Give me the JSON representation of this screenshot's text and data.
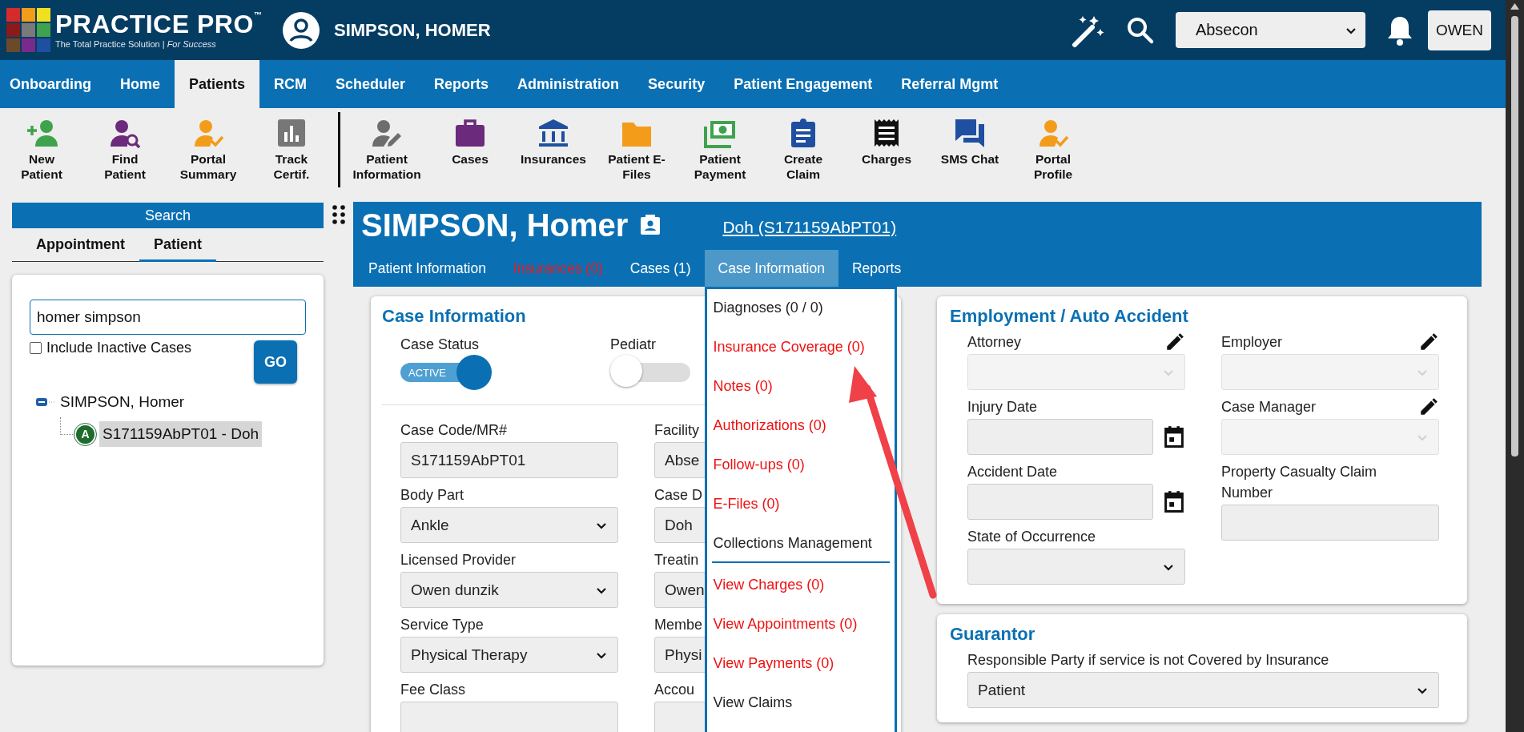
{
  "header": {
    "logo": {
      "title": "PRACTICE PRO",
      "trademark": "™",
      "tagline": "The Total Practice Solution | *For Success*"
    },
    "patient_name": "SIMPSON, HOMER",
    "location": "Absecon",
    "user": "OWEN"
  },
  "nav": [
    {
      "label": "Onboarding",
      "selected": false
    },
    {
      "label": "Home",
      "selected": false
    },
    {
      "label": "Patients",
      "selected": true
    },
    {
      "label": "RCM",
      "selected": false
    },
    {
      "label": "Scheduler",
      "selected": false
    },
    {
      "label": "Reports",
      "selected": false
    },
    {
      "label": "Administration",
      "selected": false
    },
    {
      "label": "Security",
      "selected": false
    },
    {
      "label": "Patient Engagement",
      "selected": false
    },
    {
      "label": "Referral Mgmt",
      "selected": false
    }
  ],
  "toolbar": {
    "groups": [
      [
        {
          "label": "New Patient"
        },
        {
          "label": "Find Patient"
        },
        {
          "label": "Portal Summary"
        },
        {
          "label": "Track Certif."
        }
      ],
      [
        {
          "label": "Patient Information"
        },
        {
          "label": "Cases"
        },
        {
          "label": "Insurances"
        },
        {
          "label": "Patient E-Files"
        },
        {
          "label": "Patient Payment"
        },
        {
          "label": "Create Claim"
        },
        {
          "label": "Charges"
        },
        {
          "label": "SMS Chat"
        },
        {
          "label": "Portal Profile"
        }
      ]
    ]
  },
  "sidebar": {
    "title": "Search",
    "tabs": [
      {
        "label": "Appointment",
        "selected": false
      },
      {
        "label": "Patient",
        "selected": true
      }
    ],
    "search_field": {
      "value": "homer simpson"
    },
    "include_inactive": {
      "label": "Include Inactive Cases",
      "checked": false
    },
    "go_button": "GO",
    "tree": [
      {
        "label": "SIMPSON, Homer",
        "expanded": true,
        "children": [
          {
            "badge": "A",
            "label": "S171159AbPT01 - Doh",
            "selected": true
          }
        ]
      }
    ]
  },
  "patient": {
    "name": "SIMPSON, Homer",
    "case_link": "Doh (S171159AbPT01)",
    "tabs": [
      {
        "label": "Patient Information",
        "selected": false,
        "warning": false
      },
      {
        "label": "Insurances (0)",
        "selected": false,
        "warning": true
      },
      {
        "label": "Cases (1)",
        "selected": false,
        "warning": false
      },
      {
        "label": "Case Information",
        "selected": true,
        "warning": false
      },
      {
        "label": "Reports",
        "selected": false,
        "warning": false
      }
    ]
  },
  "case_menu": {
    "items": [
      {
        "label": "Diagnoses (0 / 0)",
        "warning": false,
        "separator_after": false
      },
      {
        "label": "Insurance Coverage (0)",
        "warning": true,
        "separator_after": false
      },
      {
        "label": "Notes (0)",
        "warning": true,
        "separator_after": false
      },
      {
        "label": "Authorizations (0)",
        "warning": true,
        "separator_after": false
      },
      {
        "label": "Follow-ups (0)",
        "warning": true,
        "separator_after": false
      },
      {
        "label": "E-Files (0)",
        "warning": true,
        "separator_after": false
      },
      {
        "label": "Collections Management",
        "warning": false,
        "separator_after": true
      },
      {
        "label": "View Charges (0)",
        "warning": true,
        "separator_after": false
      },
      {
        "label": "View Appointments (0)",
        "warning": true,
        "separator_after": false
      },
      {
        "label": "View Payments (0)",
        "warning": true,
        "separator_after": false
      },
      {
        "label": "View Claims",
        "warning": false,
        "separator_after": false
      }
    ]
  },
  "case_information": {
    "title": "Case Information",
    "switches": [
      {
        "label": "Case Status",
        "on": true,
        "text": "ACTIVE"
      },
      {
        "label": "Pediatr",
        "on": false
      }
    ],
    "columns": [
      [
        {
          "label": "Case Code/MR#",
          "kind": "text",
          "value": "S171159AbPT01"
        },
        {
          "label": "Body Part",
          "kind": "select",
          "value": "Ankle"
        },
        {
          "label": "Licensed Provider",
          "kind": "select",
          "value": "Owen dunzik"
        },
        {
          "label": "Service Type",
          "kind": "select",
          "value": "Physical Therapy"
        },
        {
          "label": "Fee Class",
          "kind": "text"
        }
      ],
      [
        {
          "label": "Facility",
          "kind": "text",
          "value": "Abse"
        },
        {
          "label": "Case D",
          "kind": "text",
          "value": "Doh"
        },
        {
          "label": "Treatin",
          "kind": "text",
          "value": "Owen"
        },
        {
          "label": "Membe",
          "kind": "text",
          "value": "Physi"
        },
        {
          "label": "Accou",
          "kind": "text"
        }
      ]
    ]
  },
  "employment": {
    "title": "Employment / Auto Accident",
    "columns": [
      [
        {
          "label": "Attorney",
          "kind": "select",
          "editable": true,
          "disabled": true
        },
        {
          "label": "Injury Date",
          "kind": "date",
          "editable": false
        },
        {
          "label": "Accident Date",
          "kind": "date",
          "editable": false
        },
        {
          "label": "State of Occurrence",
          "kind": "select",
          "editable": false,
          "disabled": false
        }
      ],
      [
        {
          "label": "Employer",
          "kind": "select",
          "editable": true,
          "disabled": true
        },
        {
          "label": "Case Manager",
          "kind": "select",
          "editable": true,
          "disabled": true
        },
        {
          "label": "Property Casualty Claim Number",
          "kind": "text",
          "editable": false
        }
      ]
    ]
  },
  "guarantor": {
    "title": "Guarantor",
    "label": "Responsible Party if service is not Covered by Insurance",
    "value": "Patient"
  }
}
